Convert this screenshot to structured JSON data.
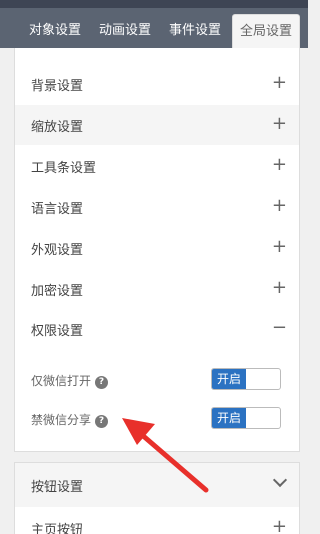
{
  "tabs": [
    {
      "label": "对象设置"
    },
    {
      "label": "动画设置"
    },
    {
      "label": "事件设置"
    },
    {
      "label": "全局设置",
      "active": true
    }
  ],
  "global_settings": {
    "rows": [
      {
        "label": "背景设置",
        "icon": "+"
      },
      {
        "label": "缩放设置",
        "icon": "+"
      },
      {
        "label": "工具条设置",
        "icon": "+"
      },
      {
        "label": "语言设置",
        "icon": "+"
      },
      {
        "label": "外观设置",
        "icon": "+"
      },
      {
        "label": "加密设置",
        "icon": "+"
      },
      {
        "label": "权限设置",
        "icon": "−"
      }
    ],
    "permissions": [
      {
        "label": "仅微信打开",
        "help": "?",
        "toggle": "开启"
      },
      {
        "label": "禁微信分享",
        "help": "?",
        "toggle": "开启"
      }
    ]
  },
  "button_settings": {
    "title": "按钮设置",
    "rows": [
      {
        "label": "主页按钮",
        "icon": "+"
      }
    ]
  },
  "colors": {
    "tab_bar": "#5b6472",
    "toggle_on": "#2b72c2",
    "annotation_arrow": "#e8302b"
  }
}
